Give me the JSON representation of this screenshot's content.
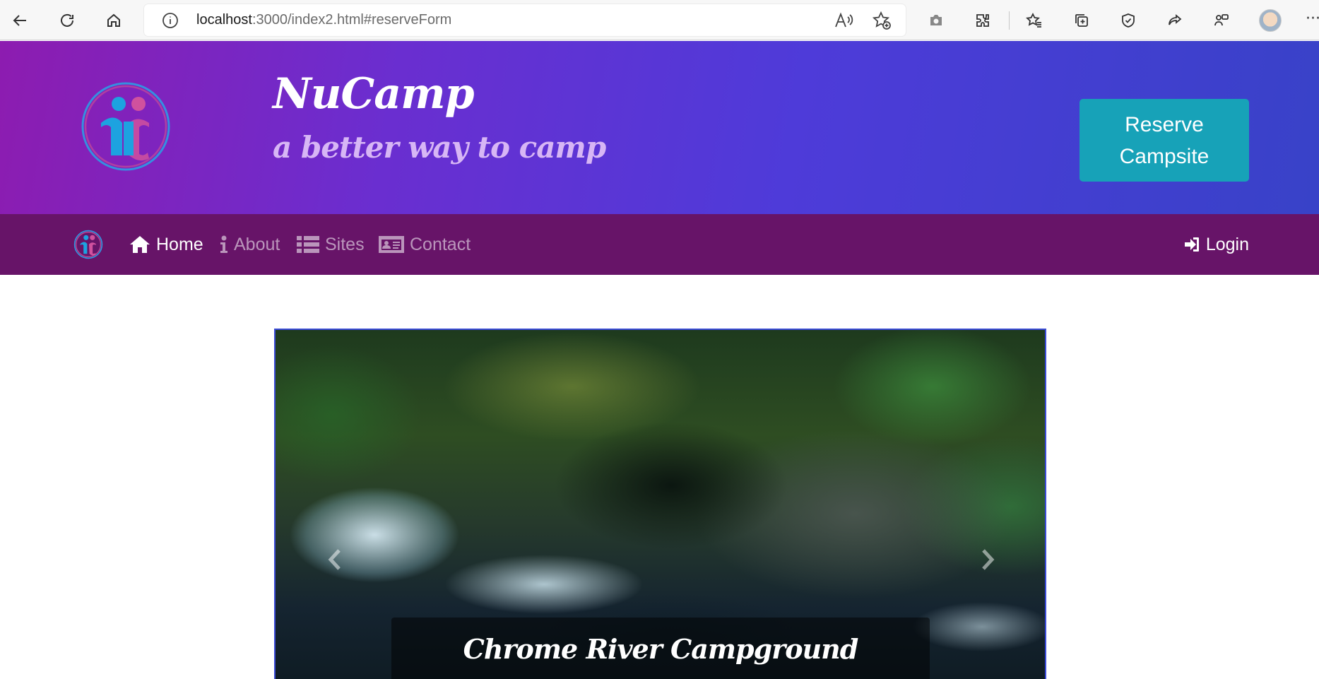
{
  "browser": {
    "url_host": "localhost",
    "url_path": ":3000/index2.html#reserveForm",
    "more_label": "···"
  },
  "header": {
    "title": "NuCamp",
    "tagline": "a better way to camp",
    "reserve_label": "Reserve Campsite"
  },
  "navbar": {
    "items": [
      {
        "label": "Home",
        "icon": "home-icon",
        "active": true
      },
      {
        "label": "About",
        "icon": "info-icon",
        "active": false
      },
      {
        "label": "Sites",
        "icon": "list-icon",
        "active": false
      },
      {
        "label": "Contact",
        "icon": "address-card-icon",
        "active": false
      }
    ],
    "login_label": "Login"
  },
  "carousel": {
    "caption_title": "Chrome River Campground",
    "prev_icon": "chevron-left-icon",
    "next_icon": "chevron-right-icon"
  },
  "colors": {
    "jumbotron_start": "#8d1cb0",
    "jumbotron_end": "#3842c8",
    "navbar": "#671468",
    "reserve_button": "#17a2b8",
    "carousel_border": "#3b4bd8"
  }
}
